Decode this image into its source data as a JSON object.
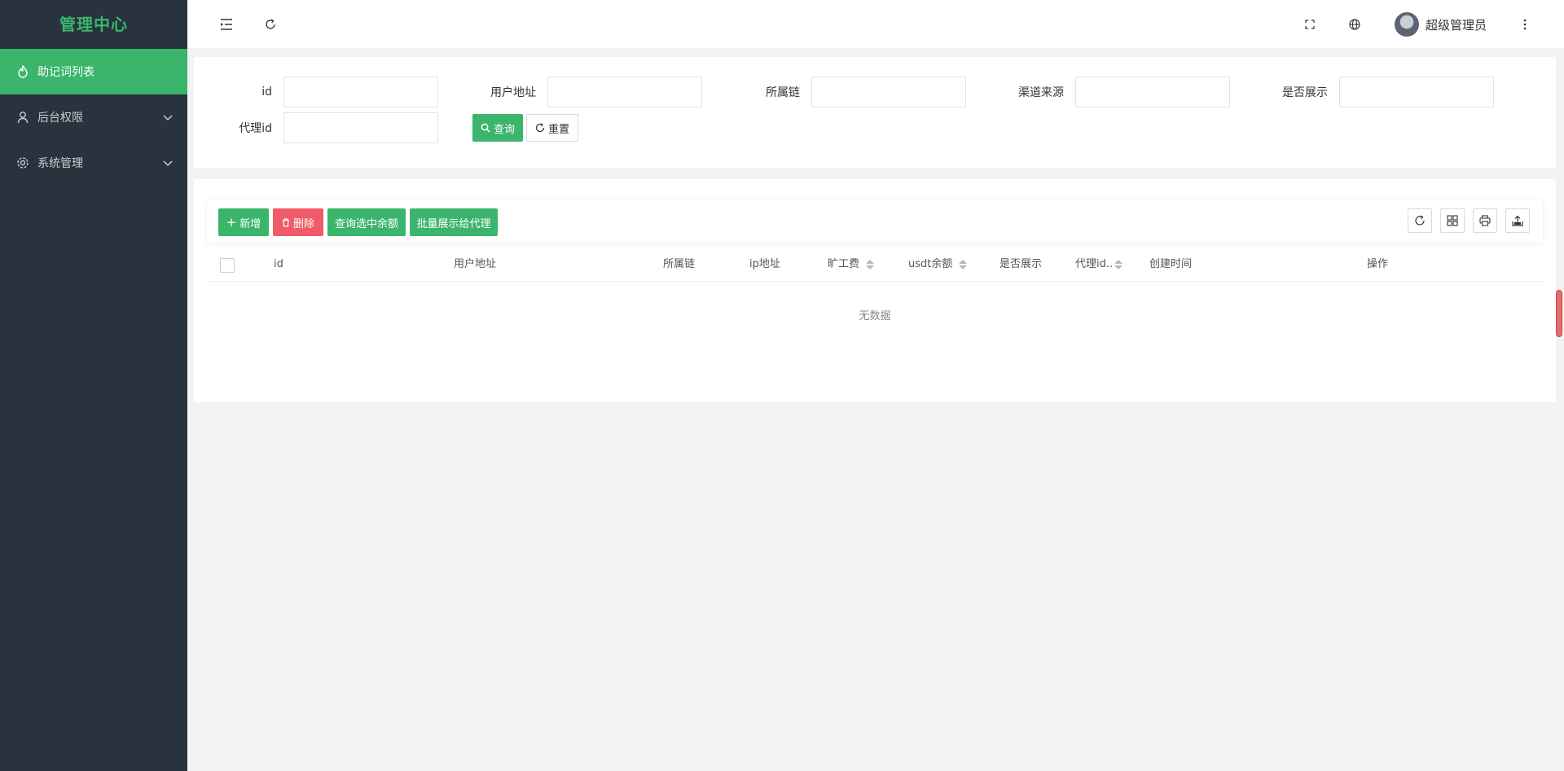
{
  "sidebar": {
    "logo": "管理中心",
    "items": [
      {
        "label": "助记词列表",
        "icon": "fire-icon",
        "active": true
      },
      {
        "label": "后台权限",
        "icon": "user-icon"
      },
      {
        "label": "系统管理",
        "icon": "gear-icon"
      }
    ]
  },
  "header": {
    "user_name": "超级管理员",
    "icons": [
      "menu-fold-icon",
      "refresh-icon",
      "fullscreen-icon",
      "globe-icon",
      "more-icon"
    ]
  },
  "search": {
    "fields": [
      {
        "label": "id",
        "value": ""
      },
      {
        "label": "用户地址",
        "value": ""
      },
      {
        "label": "所属链",
        "value": ""
      },
      {
        "label": "渠道来源",
        "value": ""
      },
      {
        "label": "是否展示",
        "value": ""
      },
      {
        "label": "代理id",
        "value": ""
      }
    ],
    "query_label": "查询",
    "reset_label": "重置"
  },
  "toolbar": {
    "add_label": "新增",
    "delete_label": "删除",
    "query_balance_label": "查询选中余额",
    "batch_show_label": "批量展示给代理",
    "icons": [
      "refresh-icon",
      "columns-icon",
      "print-icon",
      "export-icon"
    ]
  },
  "table": {
    "columns": [
      "id",
      "用户地址",
      "所属链",
      "ip地址",
      "旷工费",
      "usdt余额",
      "是否展示",
      "代理id..",
      "创建时间",
      "操作"
    ],
    "empty_text": "无数据"
  },
  "colors": {
    "accent": "#3ab56b",
    "danger": "#f05b69",
    "sidebar_bg": "#28333e"
  }
}
